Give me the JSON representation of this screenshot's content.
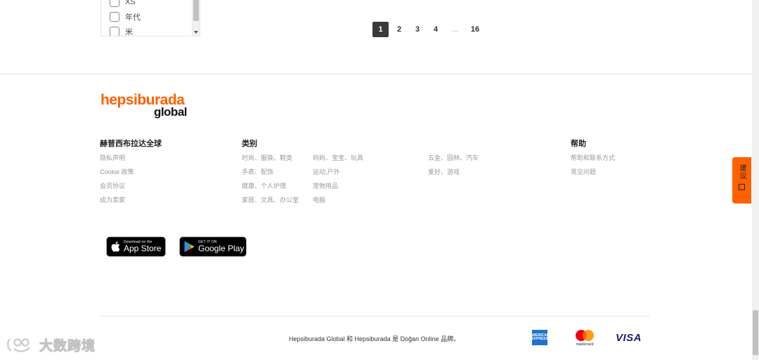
{
  "filter": {
    "items": [
      "XS",
      "年代",
      "米"
    ]
  },
  "pagination": {
    "pages": [
      "1",
      "2",
      "3",
      "4",
      "...",
      "16"
    ],
    "active": "1"
  },
  "logo": {
    "main": "hepsiburada",
    "sub": "global"
  },
  "footer": {
    "columns": [
      {
        "title": "赫普西布拉达全球",
        "items": [
          "隐私声明",
          "Cookie 政策",
          "会员协议",
          "成为卖家"
        ]
      },
      {
        "title": "类别",
        "items": [
          "时尚、服装、鞋类",
          "手表、配饰",
          "健康、个人护理",
          "家居、文具、办公室"
        ]
      },
      {
        "title": "",
        "items": [
          "妈妈、宝宝、玩具",
          "运动,户外",
          "宠物用品",
          "电脑"
        ]
      },
      {
        "title": "",
        "items": [
          "五金、园林、汽车",
          "爱好、游戏"
        ]
      },
      {
        "title": "帮助",
        "items": [
          "帮助和联系方式",
          "常见问题"
        ]
      }
    ],
    "app_store": {
      "small": "Download on the",
      "big": "App Store"
    },
    "google_play": {
      "small": "GET IT ON",
      "big": "Google Play"
    },
    "copyright": "Hepsiburada Global 和 Hepsiburada 是 Doğan Online 品牌。",
    "payments": {
      "amex": "AMERICAN EXPRESS",
      "mastercard": "mastercard",
      "visa": "VISA"
    }
  },
  "feedback": {
    "label": "建议"
  },
  "watermark": {
    "text": "大数跨境"
  },
  "colors": {
    "brand": "#ff6000",
    "active_page": "#3a3a3a",
    "visa": "#1a1f71",
    "amex": "#1f72cd"
  }
}
